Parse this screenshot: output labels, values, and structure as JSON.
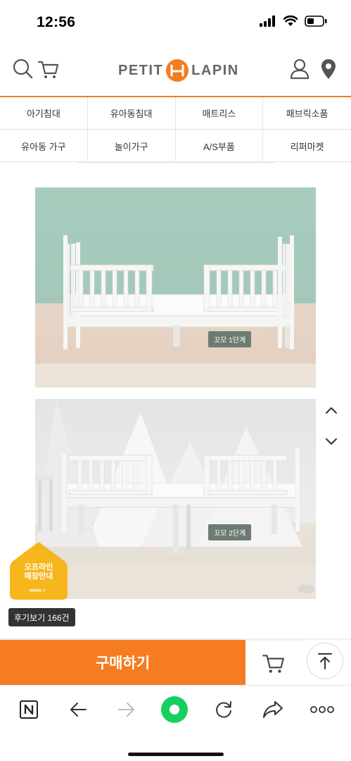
{
  "status_bar": {
    "time": "12:56",
    "icons": [
      "signal-icon",
      "wifi-icon",
      "battery-icon"
    ]
  },
  "header": {
    "logo_left": "PETIT",
    "logo_right": "LAPIN",
    "icons": [
      "search-icon",
      "cart-icon",
      "user-icon",
      "location-pin-icon"
    ]
  },
  "categories": [
    {
      "label": "아기침대"
    },
    {
      "label": "유아동침대"
    },
    {
      "label": "매트리스"
    },
    {
      "label": "패브릭소품"
    },
    {
      "label": "유아동 가구"
    },
    {
      "label": "놀이가구"
    },
    {
      "label": "A/S부품"
    },
    {
      "label": "리퍼마켓"
    }
  ],
  "product_images": [
    {
      "badge": "꼬모 1단계"
    },
    {
      "badge": "꼬모 2단계"
    }
  ],
  "offline_store": {
    "line1": "오프라인",
    "line2": "매장안내",
    "more": "more >"
  },
  "review_badge": "후기보기 166건",
  "purchase_bar": {
    "buy_label": "구매하기"
  },
  "browser_toolbar": {
    "icons": [
      "naver-n-icon",
      "back-arrow-icon",
      "forward-arrow-icon",
      "green-dot-home-icon",
      "reload-icon",
      "share-icon",
      "more-dots-icon"
    ]
  },
  "colors": {
    "brand_orange": "#f57c21",
    "naver_green": "#19ce60",
    "offline_yellow": "#f7b51e"
  }
}
